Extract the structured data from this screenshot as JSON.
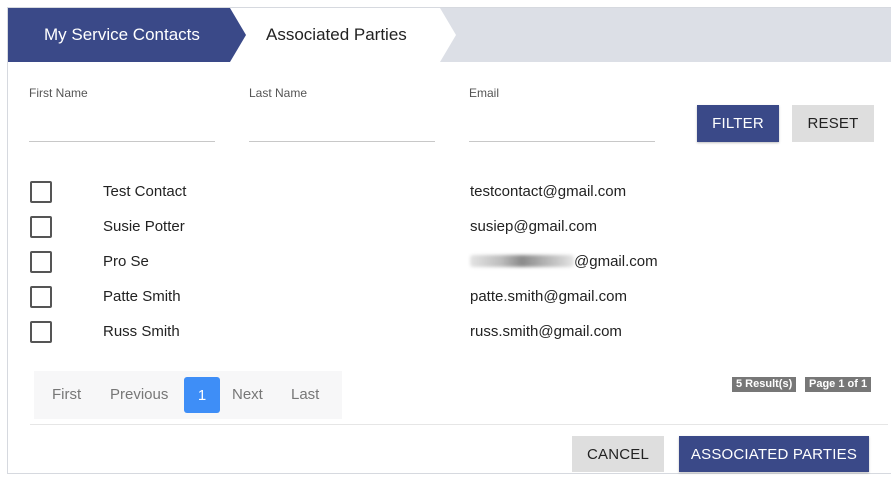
{
  "tabs": {
    "active": "My Service Contacts",
    "next": "Associated Parties"
  },
  "filters": {
    "first_name_label": "First Name",
    "last_name_label": "Last Name",
    "email_label": "Email",
    "first_name_value": "",
    "last_name_value": "",
    "email_value": "",
    "filter_button": "FILTER",
    "reset_button": "RESET"
  },
  "contacts": [
    {
      "name": "Test Contact",
      "email": "testcontact@gmail.com",
      "checked": false
    },
    {
      "name": "Susie Potter",
      "email": "susiep@gmail.com",
      "checked": false
    },
    {
      "name": "Pro Se",
      "email_visible_part": "@gmail.com",
      "email_prefix_redacted": true,
      "checked": false
    },
    {
      "name": "Patte Smith",
      "email": "patte.smith@gmail.com",
      "checked": false
    },
    {
      "name": "Russ Smith",
      "email": "russ.smith@gmail.com",
      "checked": false
    }
  ],
  "pagination": {
    "first": "First",
    "previous": "Previous",
    "current": "1",
    "next": "Next",
    "last": "Last",
    "results_badge": "5 Result(s)",
    "page_badge": "Page 1 of 1"
  },
  "footer": {
    "cancel_button": "CANCEL",
    "associated_parties_button": "ASSOCIATED PARTIES"
  },
  "colors": {
    "primary": "#3a4988",
    "page_active": "#3e8ef7",
    "tab_strip": "#dcdfe6",
    "badge": "#777777"
  }
}
